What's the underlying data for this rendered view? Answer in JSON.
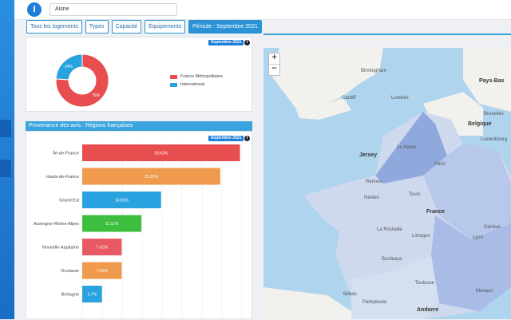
{
  "header": {
    "info_icon": "i",
    "department_value": "Aisne"
  },
  "tabs": [
    {
      "label": "Tous les logements",
      "active": false
    },
    {
      "label": "Types",
      "active": false
    },
    {
      "label": "Capacité",
      "active": false
    },
    {
      "label": "Équipements",
      "active": false
    },
    {
      "label": "Période : Septembre 2021",
      "active": true
    }
  ],
  "origin_panel": {
    "badge": "Septembre 2021",
    "chart_data": {
      "type": "pie",
      "slices": [
        {
          "name": "France Métropolitaine",
          "value": 76,
          "label": "76%",
          "color": "#e84d4f"
        },
        {
          "name": "International",
          "value": 24,
          "label": "24%",
          "color": "#29a3e0"
        }
      ]
    }
  },
  "regions_panel": {
    "title": "Provenance des avis : Régions françaises",
    "badge": "Septembre 2021",
    "chart_data": {
      "type": "bar",
      "orientation": "horizontal",
      "categories": [
        "Île-de-France",
        "Hauts-de-France",
        "Grand Est",
        "Auvergne-Rhône-Alpes",
        "Nouvelle-Aquitaine",
        "Occitanie",
        "Bretagne"
      ],
      "values": [
        29.63,
        25.93,
        14.81,
        11.11,
        7.41,
        7.41,
        3.7
      ],
      "labels": [
        "29.63%",
        "25.93%",
        "14.81%",
        "11.11%",
        "7.41%",
        "7.41%",
        "3.7%"
      ],
      "colors": [
        "#e84d4f",
        "#ef9a4c",
        "#29a3e0",
        "#3fbf3f",
        "#e85a63",
        "#ef9a4c",
        "#29a3e0"
      ],
      "xlim": [
        0,
        30
      ]
    }
  },
  "map": {
    "zoom_in": "+",
    "zoom_out": "−",
    "labels": [
      {
        "id": "birmingham",
        "text": "Birmingham",
        "big": false
      },
      {
        "id": "cardiff",
        "text": "Cardiff",
        "big": false
      },
      {
        "id": "londres",
        "text": "Londres",
        "big": false
      },
      {
        "id": "pays-bas",
        "text": "Pays-Bas",
        "big": true
      },
      {
        "id": "bruxelles",
        "text": "Bruxelles",
        "big": false
      },
      {
        "id": "belgique",
        "text": "Belgique",
        "big": true
      },
      {
        "id": "luxembourg",
        "text": "Luxembourg",
        "big": false
      },
      {
        "id": "jersey",
        "text": "Jersey",
        "big": true
      },
      {
        "id": "le-havre",
        "text": "Le Havre",
        "big": false
      },
      {
        "id": "paris",
        "text": "Paris",
        "big": false
      },
      {
        "id": "rennes",
        "text": "Rennes",
        "big": false
      },
      {
        "id": "tours",
        "text": "Tours",
        "big": false
      },
      {
        "id": "nantes",
        "text": "Nantes",
        "big": false
      },
      {
        "id": "france",
        "text": "France",
        "big": true
      },
      {
        "id": "la-rochelle",
        "text": "La Rochelle",
        "big": false
      },
      {
        "id": "limoges",
        "text": "Limoges",
        "big": false
      },
      {
        "id": "geneve",
        "text": "Genève",
        "big": false
      },
      {
        "id": "lyon",
        "text": "Lyon",
        "big": false
      },
      {
        "id": "bordeaux",
        "text": "Bordeaux",
        "big": false
      },
      {
        "id": "toulouse",
        "text": "Toulouse",
        "big": false
      },
      {
        "id": "bilbao",
        "text": "Bilbao",
        "big": false
      },
      {
        "id": "pampelune",
        "text": "Pampelune",
        "big": false
      },
      {
        "id": "andorre",
        "text": "Andorre",
        "big": true
      },
      {
        "id": "monaco",
        "text": "Monaco",
        "big": false
      }
    ]
  }
}
